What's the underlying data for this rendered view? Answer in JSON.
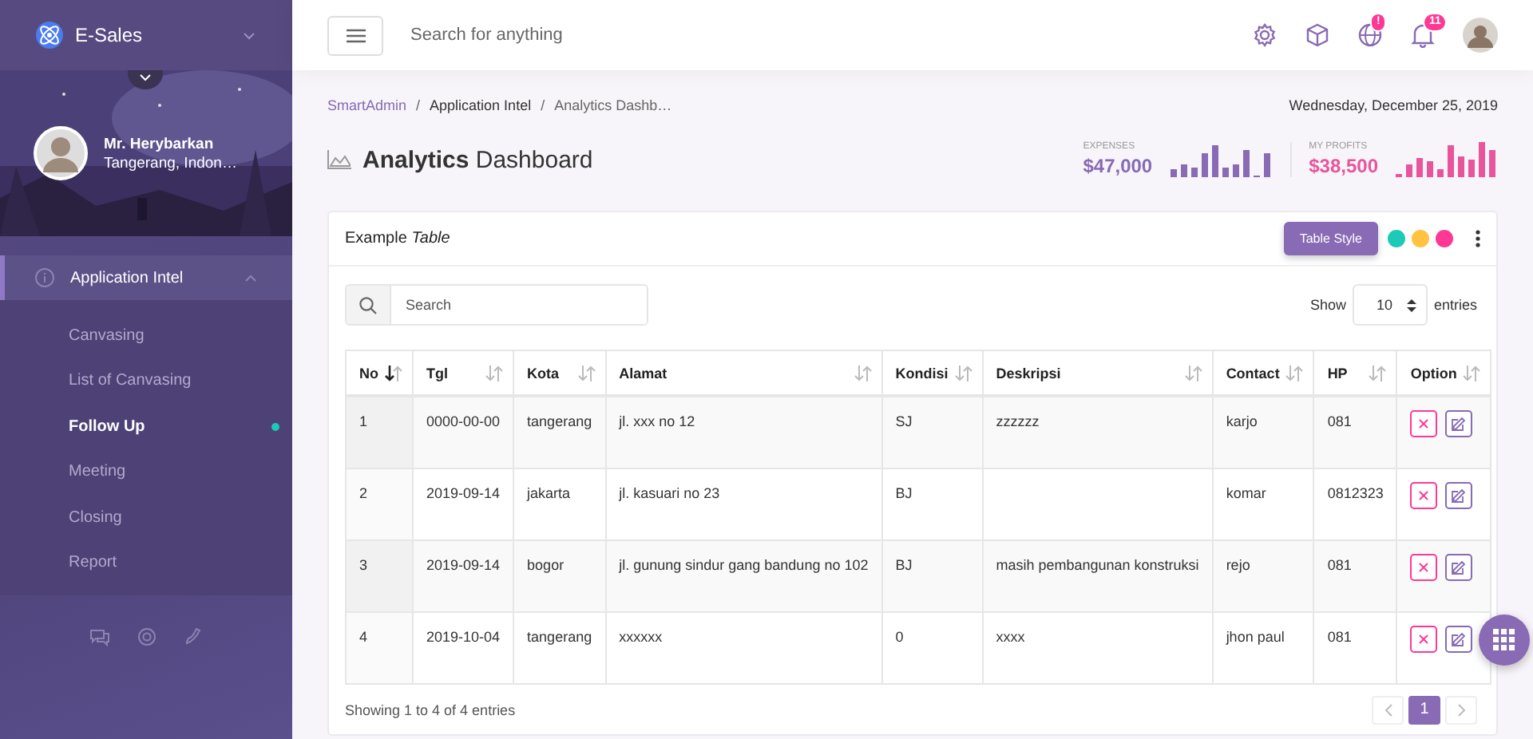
{
  "brand": {
    "name": "E-Sales"
  },
  "profile": {
    "name": "Mr. Herybarkan",
    "location": "Tangerang, Indon…"
  },
  "nav": [
    {
      "label": "Application Intel",
      "expanded": true,
      "children": [
        {
          "label": "Canvasing",
          "selected": false
        },
        {
          "label": "List of Canvasing",
          "selected": false
        },
        {
          "label": "Follow Up",
          "selected": true
        },
        {
          "label": "Meeting",
          "selected": false
        },
        {
          "label": "Closing",
          "selected": false
        },
        {
          "label": "Report",
          "selected": false
        }
      ]
    }
  ],
  "topbar": {
    "search": {
      "placeholder": "Search for anything"
    },
    "icons": [
      {
        "kind": "gear"
      },
      {
        "kind": "cube"
      },
      {
        "kind": "globe",
        "badge": "!"
      },
      {
        "kind": "bell",
        "badge": "11"
      }
    ]
  },
  "breadcrumb": [
    "SmartAdmin",
    "Application Intel",
    "Analytics Dashb…"
  ],
  "breadcrumb_separator": "/",
  "date": "Wednesday, December 25, 2019",
  "page_title": "**Analytics** Dashboard",
  "stats": [
    {
      "label": "EXPENSES",
      "value": "$47,000",
      "color": "#886ab5"
    },
    {
      "label": "MY PROFITS",
      "value": "$38,500",
      "color": "#e8559d"
    }
  ],
  "panel": {
    "title": "Example *Table*",
    "style_button": "Table Style",
    "swatches": [
      {
        "color": "#1dc9b7"
      },
      {
        "color": "#ffc241"
      },
      {
        "color": "#fd3995"
      }
    ],
    "search": {
      "placeholder": "Search"
    },
    "show_label": "Show",
    "page_size": "10",
    "entries_label": "entries",
    "columns": [
      {
        "label": "No",
        "sorted": true
      },
      {
        "label": "Tgl",
        "sorted": false
      },
      {
        "label": "Kota",
        "sorted": false
      },
      {
        "label": "Alamat",
        "sorted": false
      },
      {
        "label": "Kondisi",
        "sorted": false
      },
      {
        "label": "Deskripsi",
        "sorted": false
      },
      {
        "label": "Contact",
        "sorted": false
      },
      {
        "label": "HP",
        "sorted": false
      },
      {
        "label": "Option",
        "sorted": false
      }
    ],
    "rows": [
      [
        "1",
        "0000-00-00",
        "tangerang",
        "jl. xxx no 12",
        "SJ",
        "zzzzzz",
        "karjo",
        "081"
      ],
      [
        "2",
        "2019-09-14",
        "jakarta",
        "jl. kasuari no 23",
        "BJ",
        "",
        "komar",
        "0812323"
      ],
      [
        "3",
        "2019-09-14",
        "bogor",
        "jl. gunung sindur gang bandung no 102",
        "BJ",
        "masih pembangunan konstruksi",
        "rejo",
        "081"
      ],
      [
        "4",
        "2019-10-04",
        "tangerang",
        "xxxxxx",
        "0",
        "xxxx",
        "jhon paul",
        "081"
      ]
    ],
    "summary": "Showing 1 to 4 of 4 entries",
    "pages": [
      {
        "label": "1",
        "selected": true
      }
    ]
  }
}
